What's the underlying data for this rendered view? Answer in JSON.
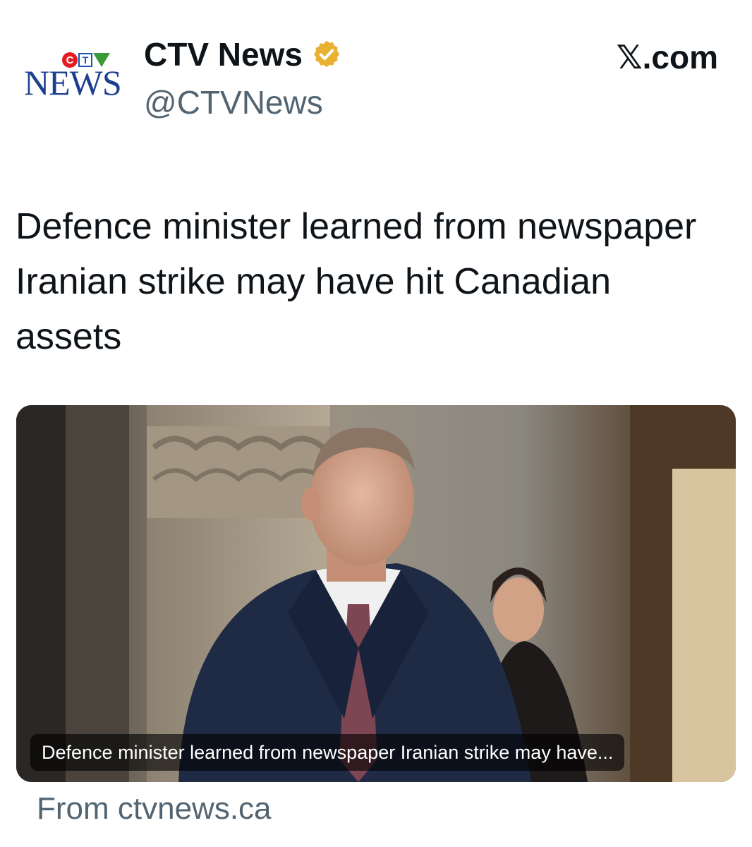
{
  "account": {
    "logo_top_letters": [
      "C",
      "T",
      "V"
    ],
    "logo_wordmark": "NEWS",
    "name": "CTV News",
    "handle": "@CTVNews",
    "verified": true,
    "badge_color": "#e8b12f"
  },
  "source_brand": "𝕏.com",
  "tweet": {
    "text": "Defence minister learned from newspaper Iranian strike may have hit Canadian assets"
  },
  "link_card": {
    "image_icon": "photo-of-man-in-suit",
    "caption": "Defence minister learned from newspaper Iranian strike may have...",
    "source": "From ctvnews.ca"
  }
}
